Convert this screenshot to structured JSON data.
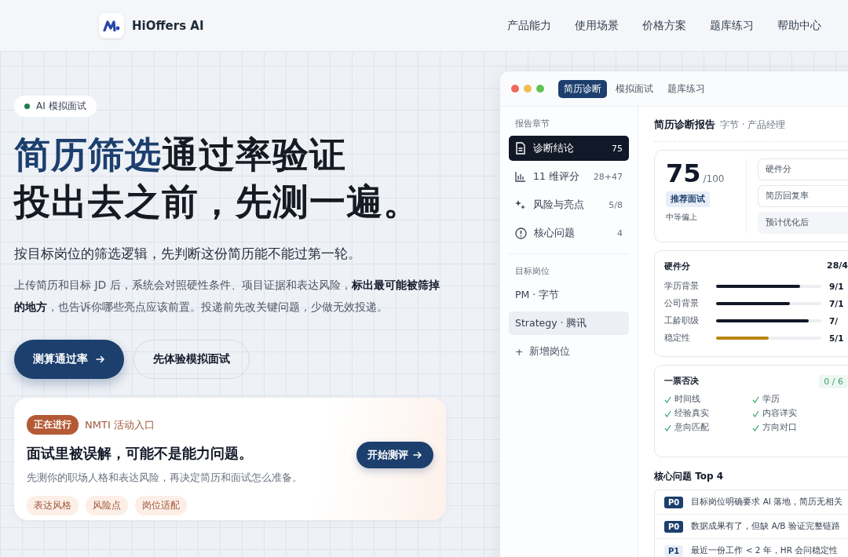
{
  "header": {
    "brand": "HiOffers AI",
    "nav": [
      "产品能力",
      "使用场景",
      "价格方案",
      "题库练习",
      "帮助中心"
    ]
  },
  "hero": {
    "badge": "AI 模拟面试",
    "title_highlight": "简历筛选",
    "title_rest": "通过率验证",
    "title_line2": "投出去之前，先测一遍。",
    "subtitle": "按目标岗位的筛选逻辑，先判断这份简历能不能过第一轮。",
    "description": "上传简历和目标 JD 后，系统会对照硬性条件、项目证据和表达风险，**标出最可能被筛掉的地方**，也告诉你哪些亮点应该前置。投递前先改关键问题，少做无效投递。",
    "primary_button": "测算通过率",
    "secondary_button": "先体验模拟面试"
  },
  "promo": {
    "status": "正在进行",
    "label": "NMTI 活动入口",
    "title": "面试里被误解，可能不是能力问题。",
    "text": "先测你的职场人格和表达风险，再决定简历和面试怎么准备。",
    "tags": [
      "表达风格",
      "风险点",
      "岗位适配"
    ],
    "button": "开始测评"
  },
  "app_window": {
    "tabs": [
      {
        "label": "简历诊断",
        "selected": true
      },
      {
        "label": "模拟面试",
        "selected": false
      },
      {
        "label": "题库练习",
        "selected": false
      }
    ],
    "sidebar": {
      "section_label": "报告章节",
      "items": [
        {
          "kind": "doc",
          "label": "诊断结论",
          "count": "75",
          "selected": true
        },
        {
          "kind": "chart",
          "label": "11 维评分",
          "count": "28+47",
          "selected": false
        },
        {
          "kind": "sparkle",
          "label": "风险与亮点",
          "count": "5/8",
          "selected": false
        },
        {
          "kind": "alert",
          "label": "核心问题",
          "count": "4",
          "selected": false
        }
      ],
      "targets_label": "目标岗位",
      "targets": [
        {
          "label": "PM · 字节",
          "selected": false
        },
        {
          "label": "Strategy · 腾讯",
          "selected": true
        }
      ],
      "add": "+",
      "add_label": "新增岗位"
    },
    "report": {
      "title": "简历诊断报告",
      "subtitle": "字节 · 产品经理",
      "score": "75",
      "score_max": "/100",
      "verdict": "推荐面试",
      "level_text": "中等偏上",
      "fields": [
        {
          "label": "硬件分",
          "kind": "plain"
        },
        {
          "label": "简历回复率",
          "kind": "plain"
        },
        {
          "label": "预计优化后",
          "kind": "muted"
        }
      ],
      "hard": {
        "title": "硬件分",
        "total": "28/4",
        "rows": [
          {
            "label": "学历背景",
            "level": 0.8,
            "value": "9/1",
            "color": "#111827"
          },
          {
            "label": "公司背景",
            "level": 0.7,
            "value": "7/1",
            "color": "#111827"
          },
          {
            "label": "工龄职级",
            "level": 0.88,
            "value": "7/",
            "color": "#111827"
          },
          {
            "label": "稳定性",
            "level": 0.5,
            "value": "5/1",
            "color": "#b8860b"
          }
        ]
      },
      "veto": {
        "title": "一票否决",
        "count": "0 / 6",
        "items": [
          {
            "label": "时间线",
            "checked": true
          },
          {
            "label": "学历",
            "checked": true
          },
          {
            "label": "经验真实",
            "checked": true
          },
          {
            "label": "内容详实",
            "checked": true
          },
          {
            "label": "意向匹配",
            "checked": true
          },
          {
            "label": "方向对口",
            "checked": true
          }
        ]
      },
      "issues_title": "核心问题 Top 4",
      "issues": [
        {
          "tag": "P0",
          "kind": "high",
          "text": "目标岗位明确要求 AI 落地，简历无相关"
        },
        {
          "tag": "P0",
          "kind": "high",
          "text": "数据成果有了，但缺 A/B 验证完整链路"
        },
        {
          "tag": "P1",
          "kind": "medium",
          "text": "最近一份工作 < 2 年，HR 会问稳定性"
        }
      ]
    }
  }
}
